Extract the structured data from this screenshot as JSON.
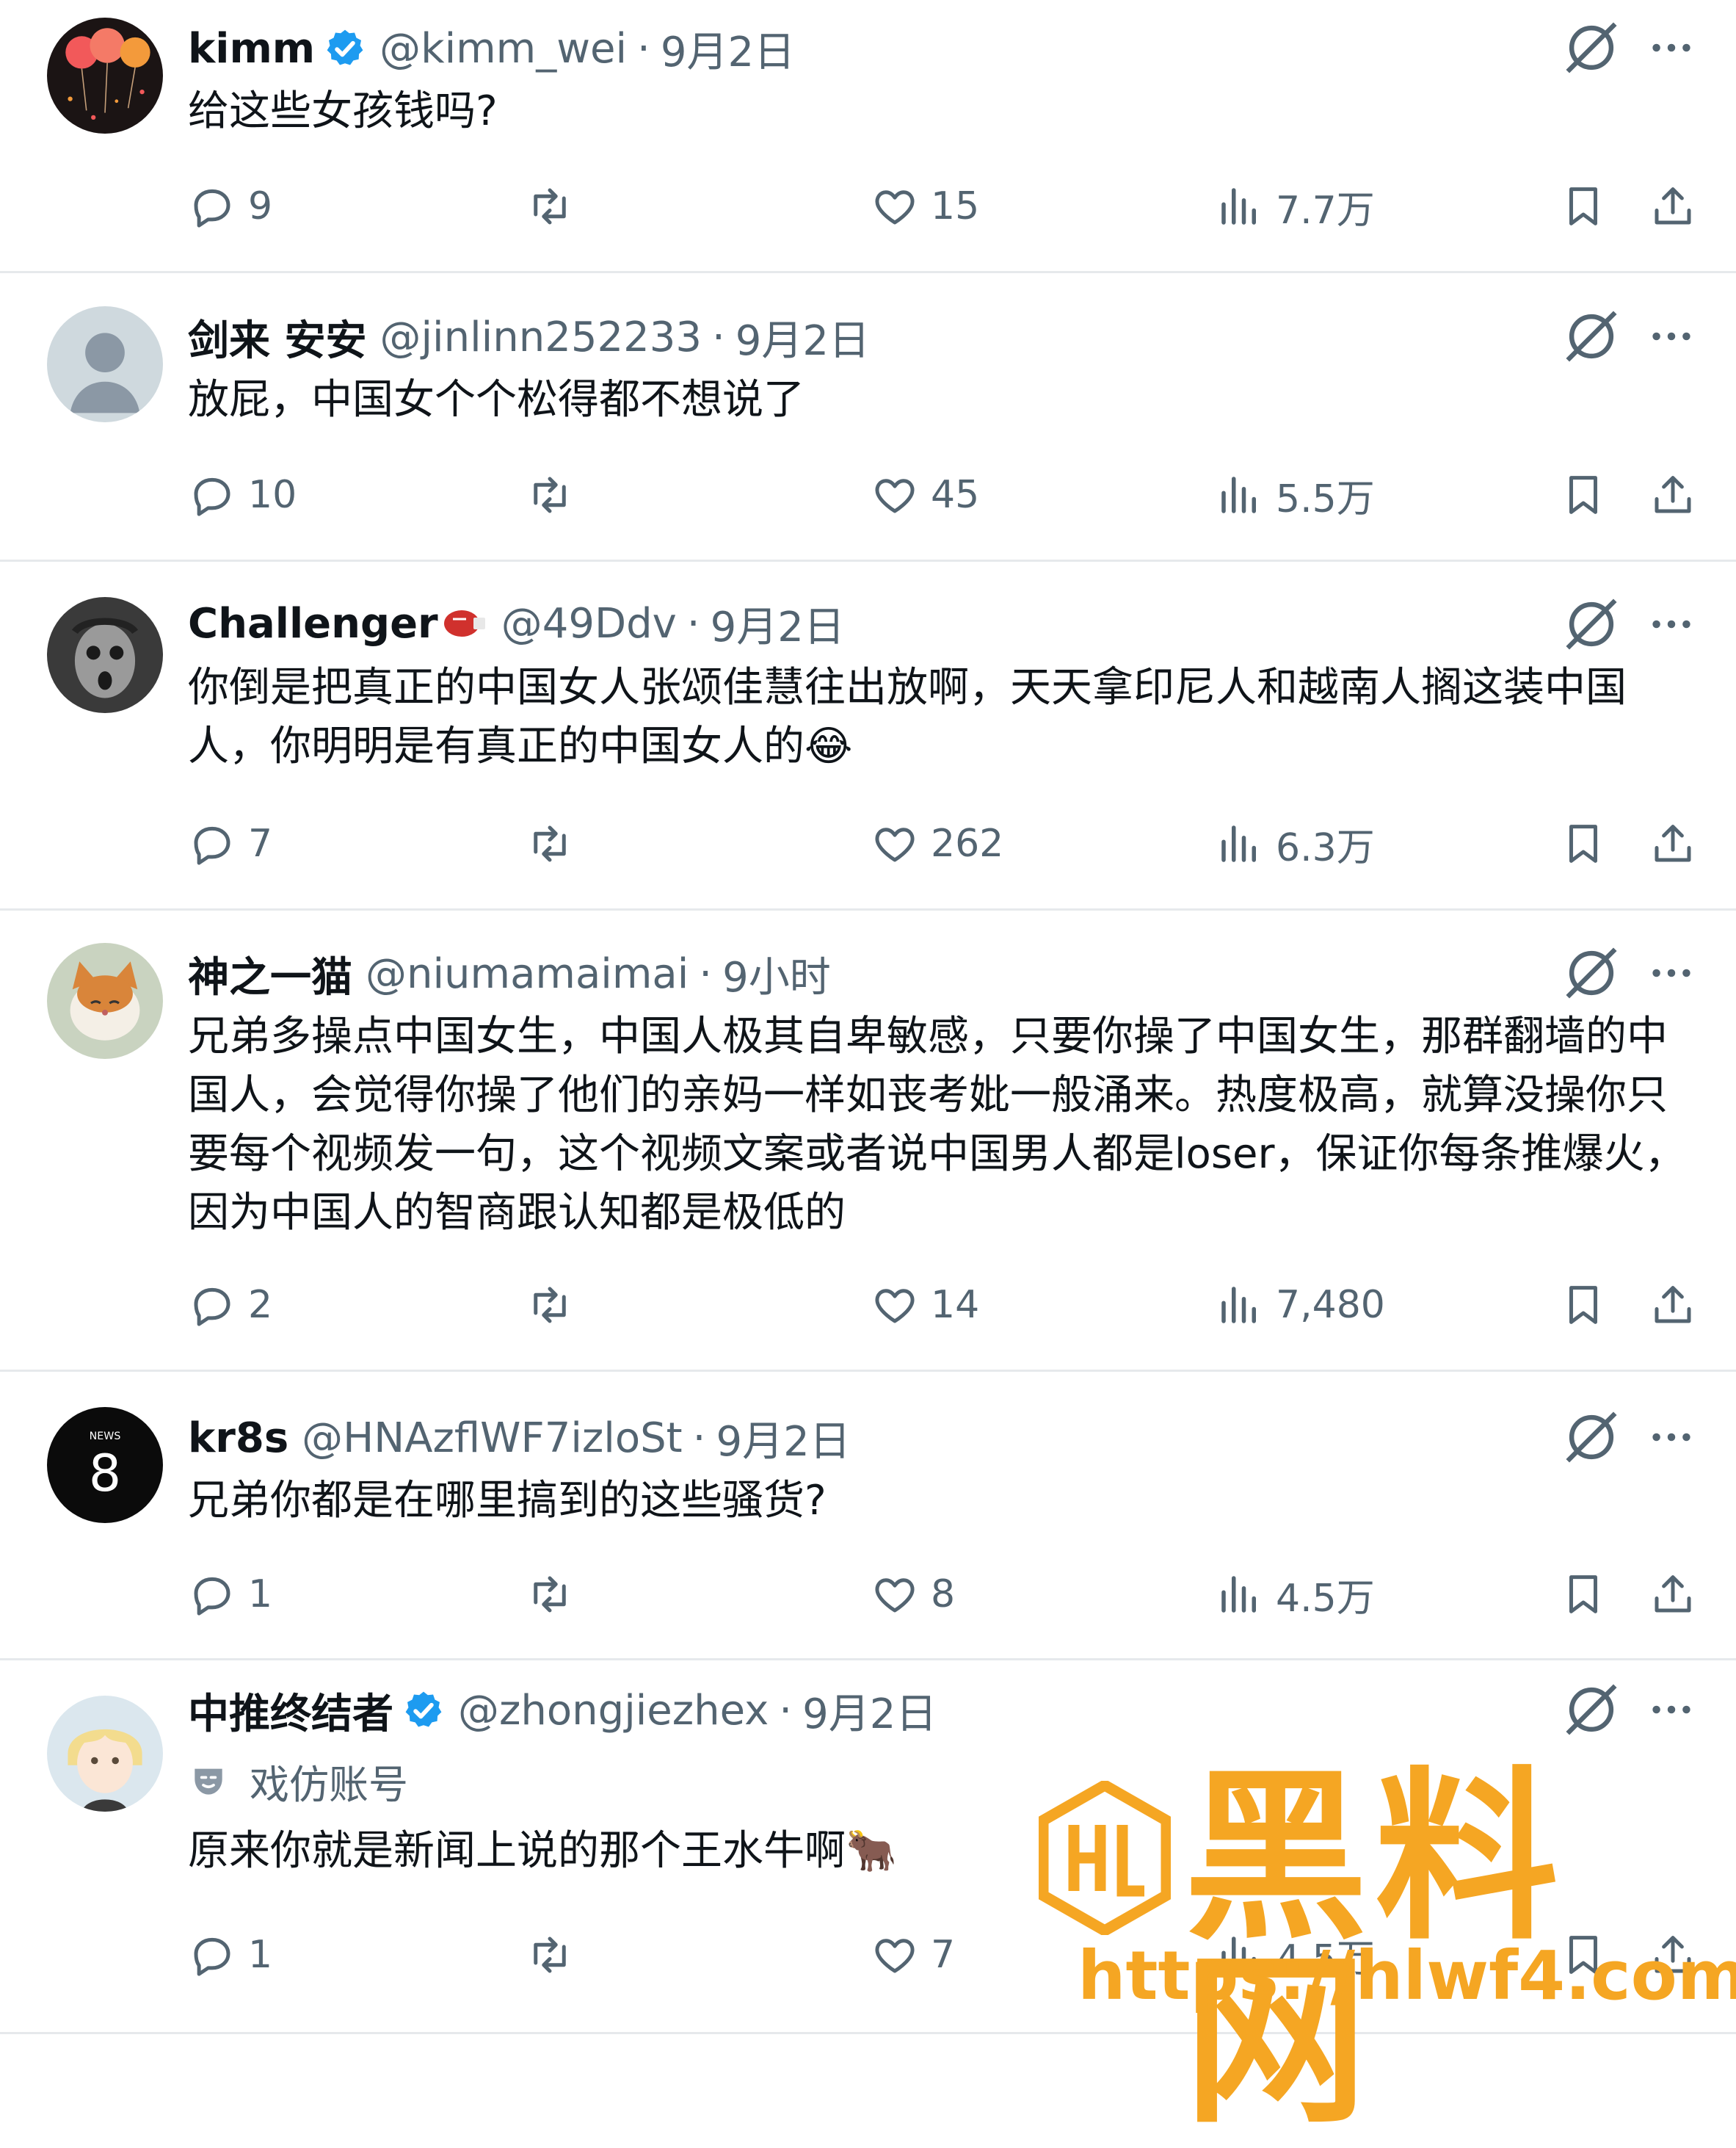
{
  "tweets": [
    {
      "name": "kimm",
      "verified": true,
      "handle": "@kimm_wei",
      "time": "9月2日",
      "text": "给这些女孩钱吗?",
      "emoji": "",
      "replies": "9",
      "retweets": "",
      "likes": "15",
      "views": "7.7万"
    },
    {
      "name": "剑来 安安",
      "verified": false,
      "handle": "@jinlinn252233",
      "time": "9月2日",
      "text": "放屁，中国女个个松得都不想说了",
      "emoji": "",
      "replies": "10",
      "retweets": "",
      "likes": "45",
      "views": "5.5万"
    },
    {
      "name": "Challenger",
      "verified": false,
      "handle": "@49Ddv",
      "time": "9月2日",
      "text": "你倒是把真正的中国女人张颂佳慧往出放啊，天天拿印尼人和越南人搁这装中国人，你明明是有真正的中国女人的",
      "emoji": "😂",
      "replies": "7",
      "retweets": "",
      "likes": "262",
      "views": "6.3万"
    },
    {
      "name": "神之一猫",
      "verified": false,
      "handle": "@niumamaimai",
      "time": "9小时",
      "text": "兄弟多操点中国女生，中国人极其自卑敏感，只要你操了中国女生，那群翻墙的中国人，会觉得你操了他们的亲妈一样如丧考妣一般涌来。热度极高，就算没操你只要每个视频发一句，这个视频文案或者说中国男人都是loser，保证你每条推爆火，因为中国人的智商跟认知都是极低的",
      "emoji": "",
      "replies": "2",
      "retweets": "",
      "likes": "14",
      "views": "7,480"
    },
    {
      "name": "kr8s",
      "verified": false,
      "handle": "@HNAzflWF7izloSt",
      "time": "9月2日",
      "text": "兄弟你都是在哪里搞到的这些骚货?",
      "emoji": "",
      "replies": "1",
      "retweets": "",
      "likes": "8",
      "views": "4.5万"
    },
    {
      "name": "中推终结者",
      "verified": true,
      "handle": "@zhongjiezhex",
      "time": "9月2日",
      "parody": "戏仿账号",
      "text": "原来你就是新闻上说的那个王水牛啊",
      "emoji": "🐂",
      "replies": "1",
      "retweets": "",
      "likes": "7",
      "views": "4.5万"
    }
  ],
  "avatar_badge": {
    "top": "NEWS",
    "digit": "8"
  },
  "watermark": {
    "title": "黑料网",
    "url": "https://hlwf4.com"
  },
  "icons": [
    "verified-badge-icon",
    "grok-icon",
    "more-icon",
    "reply-icon",
    "retweet-icon",
    "like-icon",
    "views-icon",
    "bookmark-icon",
    "share-icon",
    "parody-mask-icon"
  ],
  "colors": {
    "text": "#0f1419",
    "muted": "#536471",
    "verified": "#1d9bf0",
    "separator": "#e6e9ec",
    "watermark": "#f5a623"
  }
}
